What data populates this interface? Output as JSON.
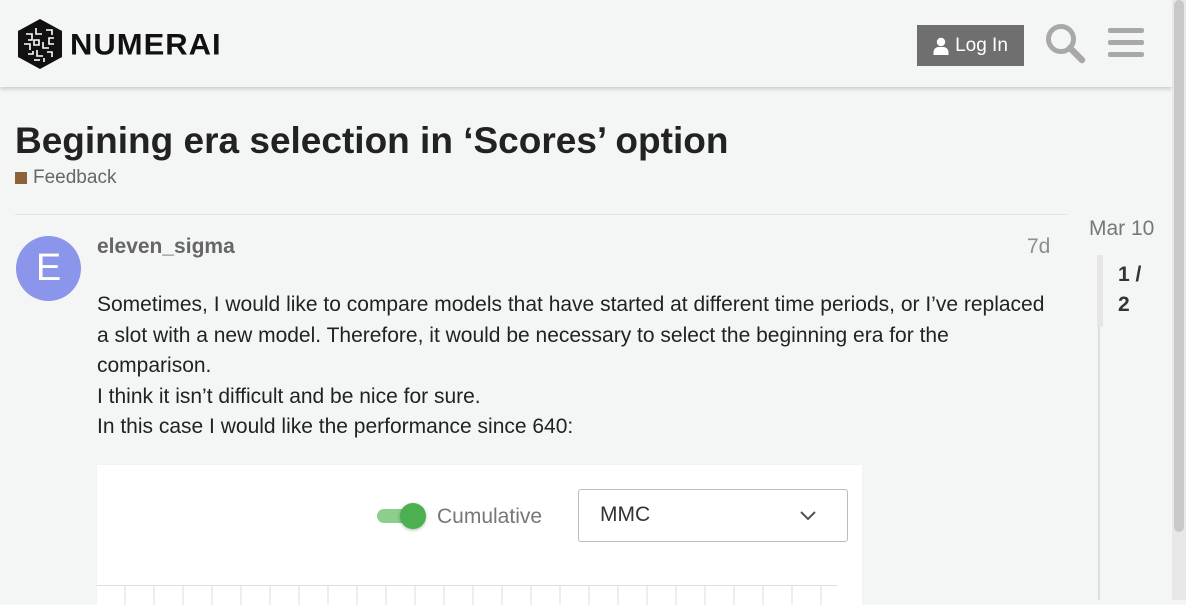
{
  "header": {
    "logo_text": "NUMERAI",
    "login_label": "Log In",
    "search_icon": "search-icon",
    "menu_icon": "hamburger-menu-icon",
    "user_icon": "user-icon"
  },
  "topic": {
    "title": "Begining era selection in ‘Scores’ option",
    "category": "Feedback",
    "category_color": "#8c6238"
  },
  "post": {
    "avatar_letter": "E",
    "avatar_color": "#8c95ec",
    "username": "eleven_sigma",
    "age": "7d",
    "paragraphs": [
      "Sometimes, I would like to compare models that have started at different time periods, or I’ve replaced a slot with a new model. Therefore, it would be necessary to select the beginning era for the comparison.",
      "I think it isn’t difficult and be nice for sure.",
      "In this case I would like the performance since 640:"
    ],
    "image": {
      "toggle_label": "Cumulative",
      "toggle_on": true,
      "select_value": "MMC"
    }
  },
  "timeline": {
    "date": "Mar 10",
    "position": "1 /",
    "total": "2"
  },
  "colors": {
    "header_bg": "#f4f6f6",
    "login_bg": "#6f6f6f",
    "toggle_on": "#4caf50"
  }
}
